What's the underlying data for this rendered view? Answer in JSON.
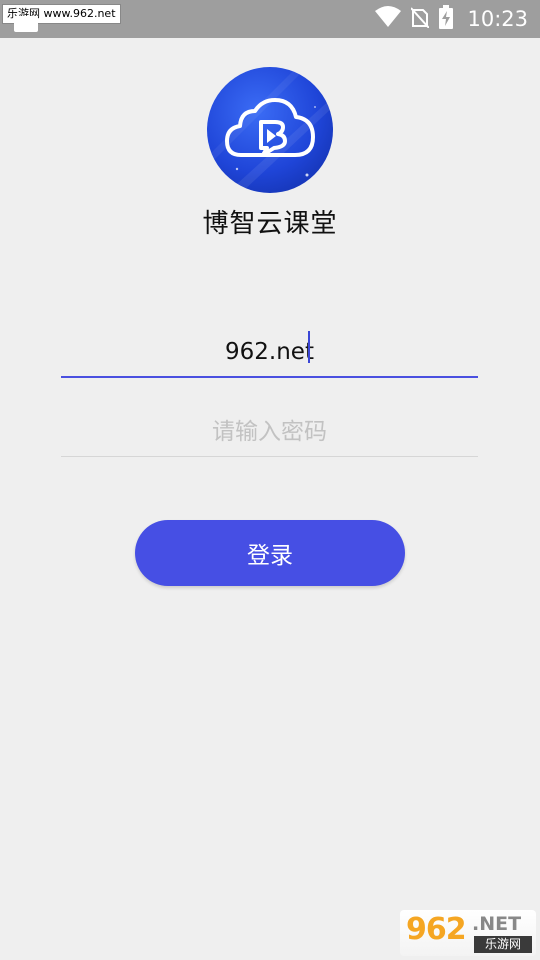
{
  "status_bar": {
    "watermark": "乐游网 www.962.net",
    "time": "10:23",
    "icons": [
      "wifi-icon",
      "no-signal-icon",
      "battery-charging-icon"
    ]
  },
  "app": {
    "title": "博智云课堂",
    "logo_letter": "B"
  },
  "login_form": {
    "username_value": "962.net",
    "password_placeholder": "请输入密码",
    "submit_label": "登录"
  },
  "site_watermark": {
    "number": "962",
    "suffix": ".NET",
    "name": "乐游网"
  },
  "colors": {
    "accent": "#464fe4",
    "background": "#efefef",
    "status_bar": "#9e9e9e"
  }
}
